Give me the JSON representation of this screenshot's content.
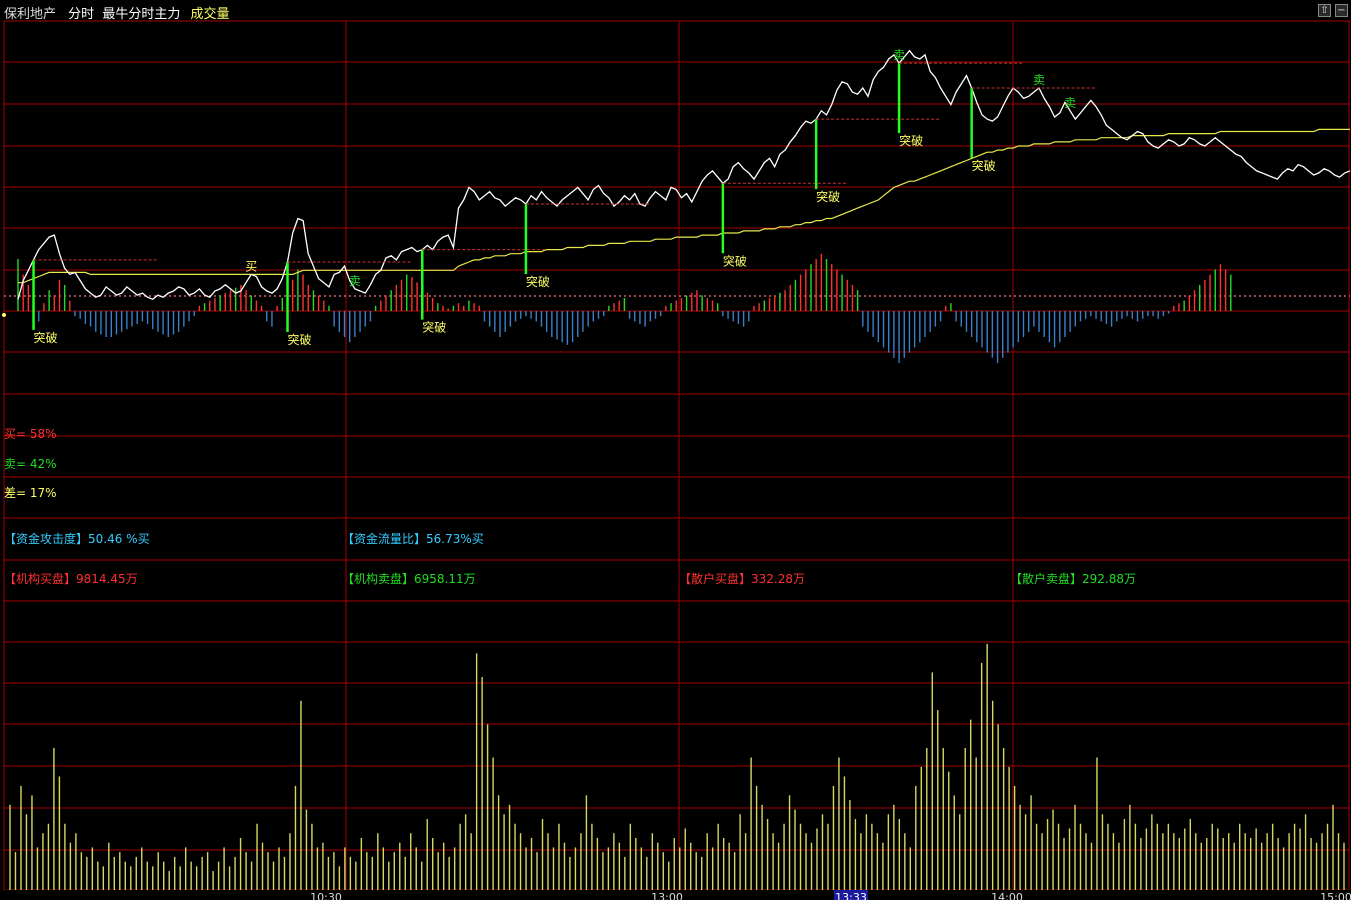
{
  "header": {
    "stock_name": "保利地产",
    "mode": "分时",
    "indicator": "最牛分时主力",
    "sub_indicator": "成交量",
    "colors": {
      "stock_name": "#dcdcdc",
      "indicator": "#ffffff",
      "sub_indicator": "#ffff66"
    }
  },
  "controls": [
    {
      "name": "up-arrow-icon",
      "glyph": "⇧"
    },
    {
      "name": "minus-icon",
      "glyph": "−"
    },
    {
      "name": "plus-icon",
      "glyph": "+"
    }
  ],
  "labels": {
    "breakout": "突破",
    "buy": "买",
    "sell": "卖"
  },
  "stats": {
    "buy": "买= 58%",
    "sell": "卖= 42%",
    "diff": "差= 17%",
    "attack_label": "【资金攻击度】",
    "attack_value": "50.46 %买",
    "flow_label": "【资金流量比】",
    "flow_value": "56.73%买",
    "inst_buy_label": "【机构买盘】",
    "inst_buy_value": "9814.45万",
    "inst_sell_label": "【机构卖盘】",
    "inst_sell_value": "6958.11万",
    "retail_buy_label": "【散户买盘】",
    "retail_buy_value": "332.28万",
    "retail_sell_label": "【散户卖盘】",
    "retail_sell_value": "292.88万"
  },
  "time_axis": {
    "ticks": [
      "10:30",
      "13:00",
      "14:00",
      "15:00"
    ],
    "cursor": "13:33"
  },
  "colors": {
    "grid": "#a40000",
    "price": "#ffffff",
    "avg": "#e8e84a",
    "breakout": "#22ff22",
    "volume": "#d8d860",
    "stem_red": "#ff3030",
    "stem_green": "#22dd22",
    "stem_blue": "#3a7fc8"
  },
  "chart_data": {
    "type": "line",
    "title": "",
    "price": [
      10,
      19,
      24,
      29,
      34,
      37,
      40,
      41,
      32,
      25,
      22,
      23,
      19,
      15,
      13,
      11,
      12,
      16,
      14,
      12,
      13,
      16,
      14,
      12,
      13,
      11,
      10,
      12,
      11,
      13,
      14,
      16,
      15,
      12,
      13,
      15,
      12,
      11,
      14,
      15,
      17,
      15,
      13,
      14,
      18,
      22,
      21,
      16,
      14,
      13,
      15,
      20,
      28,
      42,
      49,
      48,
      32,
      26,
      20,
      18,
      16,
      22,
      23,
      26,
      19,
      15,
      14,
      13,
      17,
      22,
      24,
      30,
      31,
      29,
      33,
      34,
      35,
      33,
      34,
      36,
      34,
      38,
      40,
      41,
      35,
      54,
      58,
      64,
      62,
      58,
      60,
      62,
      59,
      58,
      55,
      57,
      59,
      58,
      56,
      60,
      58,
      62,
      59,
      57,
      55,
      58,
      60,
      62,
      64,
      61,
      58,
      63,
      65,
      61,
      59,
      55,
      57,
      60,
      58,
      61,
      56,
      55,
      59,
      62,
      60,
      58,
      64,
      63,
      59,
      61,
      57,
      62,
      67,
      70,
      72,
      69,
      66,
      68,
      74,
      76,
      73,
      71,
      68,
      72,
      76,
      78,
      74,
      80,
      82,
      86,
      89,
      93,
      96,
      95,
      97,
      101,
      99,
      104,
      111,
      115,
      114,
      110,
      109,
      112,
      108,
      116,
      120,
      122,
      126,
      128,
      124,
      127,
      130,
      127,
      126,
      128,
      120,
      117,
      112,
      108,
      104,
      110,
      114,
      118,
      112,
      105,
      99,
      97,
      96,
      98,
      103,
      108,
      112,
      110,
      107,
      108,
      110,
      112,
      107,
      103,
      98,
      100,
      105,
      101,
      97,
      100,
      103,
      106,
      103,
      99,
      94,
      92,
      90,
      88,
      87,
      89,
      91,
      90,
      86,
      84,
      83,
      85,
      87,
      86,
      84,
      85,
      88,
      87,
      85,
      84,
      86,
      88,
      86,
      84,
      82,
      80,
      79,
      76,
      74,
      72,
      71,
      70,
      69,
      68,
      71,
      73,
      72,
      75,
      74,
      72,
      70,
      71,
      73,
      72,
      70,
      69,
      71,
      72
    ],
    "avg": [
      18,
      18,
      19,
      20,
      21,
      22,
      23,
      23,
      23,
      23,
      23,
      23,
      23,
      23,
      22,
      22,
      22,
      22,
      22,
      22,
      22,
      22,
      22,
      22,
      22,
      22,
      22,
      22,
      22,
      22,
      22,
      22,
      22,
      22,
      22,
      22,
      22,
      22,
      22,
      22,
      22,
      22,
      22,
      22,
      22,
      22,
      22,
      22,
      22,
      22,
      22,
      22,
      22,
      22,
      23,
      24,
      24,
      24,
      24,
      24,
      24,
      24,
      24,
      24,
      24,
      24,
      24,
      24,
      24,
      24,
      24,
      24,
      24,
      24,
      24,
      24,
      24,
      24,
      24,
      24,
      24,
      24,
      24,
      24,
      24,
      26,
      27,
      28,
      29,
      29,
      30,
      30,
      31,
      31,
      31,
      32,
      32,
      32,
      33,
      33,
      33,
      33,
      34,
      34,
      34,
      34,
      35,
      35,
      35,
      35,
      36,
      36,
      36,
      36,
      37,
      37,
      37,
      37,
      38,
      38,
      38,
      38,
      38,
      39,
      39,
      39,
      39,
      40,
      40,
      40,
      40,
      40,
      41,
      41,
      41,
      41,
      42,
      42,
      42,
      42,
      43,
      43,
      43,
      43,
      44,
      44,
      44,
      45,
      45,
      45,
      46,
      46,
      47,
      47,
      48,
      48,
      49,
      49,
      50,
      51,
      52,
      53,
      54,
      55,
      56,
      57,
      58,
      60,
      62,
      64,
      65,
      66,
      67,
      67,
      68,
      69,
      70,
      71,
      72,
      73,
      74,
      75,
      76,
      77,
      78,
      79,
      80,
      81,
      81,
      82,
      82,
      83,
      83,
      84,
      84,
      84,
      85,
      85,
      85,
      85,
      86,
      86,
      86,
      86,
      87,
      87,
      87,
      87,
      87,
      88,
      88,
      88,
      88,
      88,
      88,
      89,
      89,
      89,
      89,
      89,
      89,
      89,
      90,
      90,
      90,
      90,
      90,
      90,
      90,
      90,
      90,
      90,
      91,
      91,
      91,
      91,
      91,
      91,
      91,
      91,
      91,
      91,
      91,
      91,
      91,
      91,
      91,
      91,
      91,
      91,
      91,
      92,
      92,
      92,
      92,
      92,
      92,
      92
    ],
    "price_range": [
      0,
      140
    ],
    "breakouts": [
      3,
      52,
      78,
      98,
      136,
      154,
      170,
      184
    ],
    "volume": [
      18,
      8,
      22,
      16,
      20,
      9,
      12,
      14,
      30,
      24,
      14,
      10,
      12,
      8,
      7,
      9,
      6,
      5,
      10,
      7,
      8,
      6,
      5,
      7,
      9,
      6,
      5,
      8,
      6,
      4,
      7,
      5,
      9,
      6,
      5,
      7,
      8,
      4,
      6,
      9,
      5,
      7,
      11,
      8,
      6,
      14,
      10,
      8,
      6,
      9,
      7,
      12,
      22,
      40,
      17,
      14,
      9,
      10,
      7,
      8,
      5,
      9,
      7,
      6,
      11,
      8,
      7,
      12,
      9,
      6,
      8,
      10,
      7,
      12,
      9,
      6,
      15,
      11,
      8,
      10,
      7,
      9,
      14,
      16,
      12,
      50,
      45,
      35,
      28,
      20,
      16,
      18,
      14,
      12,
      9,
      11,
      8,
      15,
      12,
      9,
      14,
      10,
      7,
      9,
      12,
      20,
      14,
      11,
      8,
      9,
      12,
      10,
      7,
      14,
      11,
      9,
      7,
      12,
      10,
      8,
      6,
      11,
      9,
      13,
      10,
      8,
      7,
      12,
      9,
      14,
      11,
      10,
      8,
      16,
      12,
      28,
      22,
      18,
      15,
      12,
      10,
      14,
      20,
      17,
      14,
      12,
      10,
      13,
      16,
      14,
      22,
      28,
      24,
      19,
      15,
      12,
      16,
      14,
      12,
      10,
      16,
      18,
      15,
      12,
      9,
      22,
      26,
      30,
      46,
      38,
      30,
      25,
      20,
      16,
      30,
      36,
      28,
      48,
      52,
      40,
      35,
      30,
      26,
      22,
      18,
      16,
      20,
      14,
      12,
      15,
      17,
      14,
      11,
      13,
      18,
      14,
      12,
      10,
      28,
      16,
      14,
      12,
      10,
      15,
      18,
      14,
      11,
      13,
      16,
      14,
      12,
      14,
      12,
      11,
      13,
      15,
      12,
      10,
      11,
      14,
      13,
      11,
      12,
      10,
      14,
      12,
      11,
      13,
      10,
      12,
      14,
      11,
      9,
      12,
      14,
      13,
      16,
      11,
      10,
      12,
      14,
      18,
      12,
      10
    ],
    "stems": [
      20,
      14,
      10,
      -6,
      -4,
      3,
      8,
      6,
      12,
      10,
      4,
      -2,
      -3,
      -5,
      -6,
      -8,
      -9,
      -10,
      -10,
      -9,
      -8,
      -7,
      -6,
      -5,
      -4,
      -5,
      -7,
      -8,
      -9,
      -10,
      -9,
      -8,
      -6,
      -4,
      -2,
      2,
      3,
      4,
      5,
      6,
      7,
      8,
      9,
      10,
      8,
      6,
      4,
      2,
      -4,
      -6,
      2,
      5,
      9,
      12,
      16,
      14,
      10,
      8,
      6,
      4,
      2,
      -6,
      -8,
      -10,
      -12,
      -10,
      -8,
      -6,
      -4,
      2,
      4,
      6,
      8,
      10,
      12,
      14,
      13,
      11,
      9,
      7,
      5,
      3,
      2,
      1,
      2,
      3,
      2,
      4,
      3,
      2,
      -4,
      -6,
      -8,
      -10,
      -8,
      -6,
      -4,
      -3,
      -2,
      -3,
      -4,
      -6,
      -8,
      -10,
      -11,
      -12,
      -13,
      -12,
      -10,
      -8,
      -6,
      -4,
      -3,
      -2,
      2,
      3,
      4,
      5,
      -3,
      -4,
      -5,
      -6,
      -4,
      -3,
      -2,
      2,
      3,
      4,
      5,
      6,
      7,
      8,
      6,
      5,
      4,
      3,
      -2,
      -3,
      -4,
      -5,
      -6,
      -4,
      2,
      3,
      4,
      5,
      6,
      7,
      8,
      10,
      12,
      14,
      16,
      18,
      20,
      22,
      20,
      18,
      16,
      14,
      12,
      10,
      8,
      -6,
      -8,
      -10,
      -12,
      -14,
      -16,
      -18,
      -20,
      -18,
      -16,
      -14,
      -12,
      -10,
      -8,
      -6,
      -4,
      2,
      3,
      -4,
      -6,
      -8,
      -10,
      -12,
      -14,
      -16,
      -18,
      -20,
      -18,
      -16,
      -14,
      -12,
      -10,
      -8,
      -6,
      -8,
      -10,
      -12,
      -14,
      -12,
      -10,
      -8,
      -6,
      -4,
      -3,
      -2,
      -3,
      -4,
      -5,
      -6,
      -4,
      -3,
      -2,
      -3,
      -4,
      -3,
      -2,
      -2,
      -3,
      -2,
      -1,
      2,
      3,
      4,
      6,
      8,
      10,
      12,
      14,
      16,
      18,
      16,
      14
    ],
    "signals": [
      {
        "label": "买",
        "index": 45
      },
      {
        "label": "卖",
        "index": 65
      },
      {
        "label": "卖",
        "index": 170
      },
      {
        "label": "卖",
        "index": 197
      },
      {
        "label": "卖",
        "index": 203
      }
    ]
  }
}
